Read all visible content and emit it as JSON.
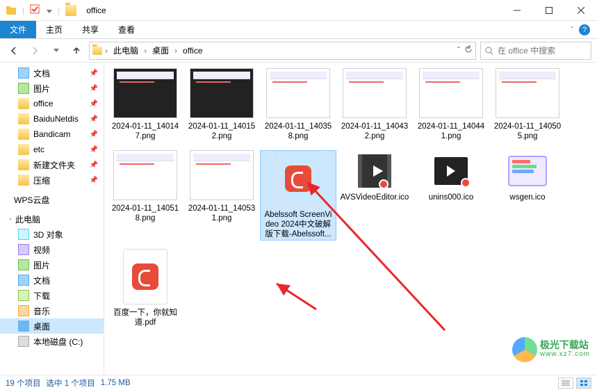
{
  "window": {
    "title": "office"
  },
  "ribbon": {
    "file": "文件",
    "tabs": [
      "主页",
      "共享",
      "查看"
    ]
  },
  "breadcrumb": {
    "items": [
      "此电脑",
      "桌面",
      "office"
    ]
  },
  "search": {
    "placeholder": "在 office 中搜索"
  },
  "sidebar": {
    "quick": [
      {
        "label": "文档",
        "icon": "ico-doc",
        "pinned": true
      },
      {
        "label": "图片",
        "icon": "ico-img",
        "pinned": true
      },
      {
        "label": "office",
        "icon": "ico-fold",
        "pinned": true
      },
      {
        "label": "BaiduNetdis",
        "icon": "ico-fold",
        "pinned": true
      },
      {
        "label": "Bandicam",
        "icon": "ico-fold",
        "pinned": true
      },
      {
        "label": "etc",
        "icon": "ico-fold",
        "pinned": true
      },
      {
        "label": "新建文件夹",
        "icon": "ico-fold",
        "pinned": true
      },
      {
        "label": "压缩",
        "icon": "ico-fold",
        "pinned": true
      }
    ],
    "wps": "WPS云盘",
    "pc": "此电脑",
    "pc_items": [
      {
        "label": "3D 对象",
        "icon": "ico-3d"
      },
      {
        "label": "视频",
        "icon": "ico-video"
      },
      {
        "label": "图片",
        "icon": "ico-img"
      },
      {
        "label": "文档",
        "icon": "ico-doc"
      },
      {
        "label": "下载",
        "icon": "ico-dl"
      },
      {
        "label": "音乐",
        "icon": "ico-music"
      },
      {
        "label": "桌面",
        "icon": "ico-desk",
        "selected": true
      },
      {
        "label": "本地磁盘 (C:)",
        "icon": "ico-disk"
      }
    ]
  },
  "files": [
    {
      "name": "2024-01-11_140147.png",
      "type": "shot",
      "dark": true
    },
    {
      "name": "2024-01-11_140152.png",
      "type": "shot",
      "dark": true
    },
    {
      "name": "2024-01-11_140358.png",
      "type": "shot"
    },
    {
      "name": "2024-01-11_140432.png",
      "type": "shot"
    },
    {
      "name": "2024-01-11_140441.png",
      "type": "shot"
    },
    {
      "name": "2024-01-11_140505.png",
      "type": "shot"
    },
    {
      "name": "2024-01-11_140518.png",
      "type": "shot"
    },
    {
      "name": "2024-01-11_140531.png",
      "type": "shot"
    },
    {
      "name": "Abelssoft ScreenVideo 2024中文破解版下载-Abelssoft...",
      "type": "pdf",
      "selected": true
    },
    {
      "name": "AVSVideoEditor.ico",
      "type": "film"
    },
    {
      "name": "unins000.ico",
      "type": "unins"
    },
    {
      "name": "wsgen.ico",
      "type": "wsgen"
    },
    {
      "name": "百度一下，你就知道.pdf",
      "type": "pdf"
    }
  ],
  "status": {
    "count": "19 个项目",
    "selection": "选中 1 个项目",
    "size": "1.75 MB"
  },
  "watermark": {
    "zh": "极光下载站",
    "en": "www.xz7.com"
  }
}
